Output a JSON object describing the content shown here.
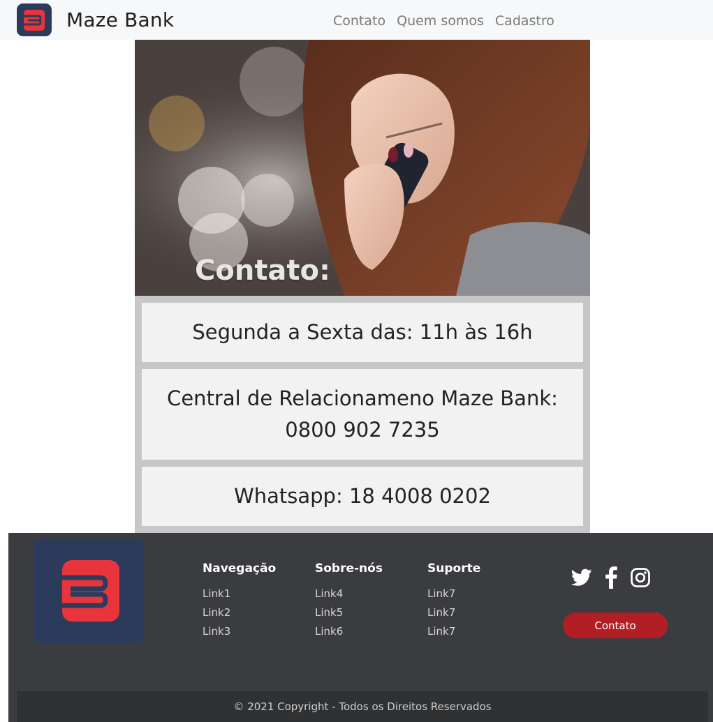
{
  "navbar": {
    "brand_name": "Maze Bank",
    "links": [
      "Contato",
      "Quem somos",
      "Cadastro"
    ]
  },
  "hero": {
    "title": "Contato:"
  },
  "info": {
    "hours": "Segunda a Sexta das: 11h às 16h",
    "central": "Central de Relacionameno Maze Bank: 0800 902 7235",
    "whatsapp": "Whatsapp: 18 4008 0202"
  },
  "footer": {
    "columns": [
      {
        "title": "Navegação",
        "links": [
          "Link1",
          "Link2",
          "Link3"
        ]
      },
      {
        "title": "Sobre-nós",
        "links": [
          "Link4",
          "Link5",
          "Link6"
        ]
      },
      {
        "title": "Suporte",
        "links": [
          "Link7",
          "Link7",
          "Link7"
        ]
      }
    ],
    "social_icons": [
      "twitter-icon",
      "facebook-icon",
      "instagram-icon"
    ],
    "contact_button": "Contato",
    "copyright": "© 2021 Copyright - Todos os Direitos Reservados"
  },
  "colors": {
    "brand_navy": "#2c3b5c",
    "brand_red": "#e8353b",
    "footer_bg": "#3b3c40",
    "button_red": "#b11f24"
  }
}
